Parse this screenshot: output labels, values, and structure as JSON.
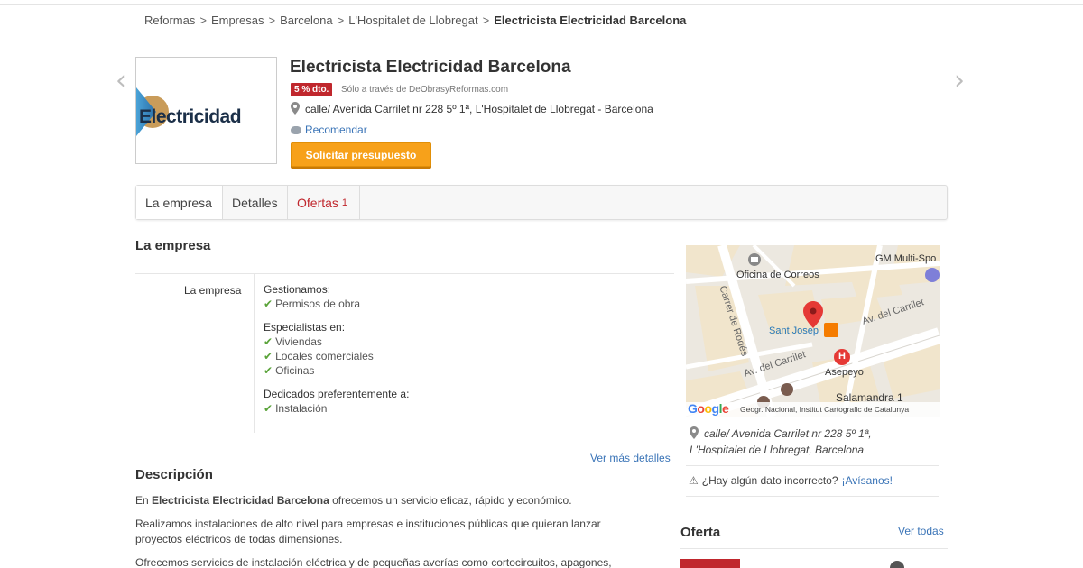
{
  "breadcrumb": [
    {
      "label": "Reformas"
    },
    {
      "label": "Empresas"
    },
    {
      "label": "Barcelona"
    },
    {
      "label": "L'Hospitalet de Llobregat"
    },
    {
      "label": "Electricista Electricidad Barcelona"
    }
  ],
  "breadcrumb_separator": ">",
  "logo": {
    "text": "Electricidad"
  },
  "business": {
    "title": "Electricista Electricidad Barcelona",
    "discount_badge": "5 % dto.",
    "discount_note": "Sólo a través de DeObrasyReformas.com",
    "address": "calle/ Avenida Carrilet nr 228 5º 1ª, L'Hospitalet de Llobregat  -  Barcelona",
    "recommend_label": "Recomendar",
    "quote_button": "Solicitar presupuesto"
  },
  "tabs": [
    {
      "label": "La empresa"
    },
    {
      "label": "Detalles"
    },
    {
      "label": "Ofertas",
      "count": "1"
    }
  ],
  "empresa": {
    "heading": "La empresa",
    "row_label": "La empresa",
    "groups": [
      {
        "title": "Gestionamos:",
        "items": [
          "Permisos de obra"
        ]
      },
      {
        "title": "Especialistas en:",
        "items": [
          "Viviendas",
          "Locales comerciales",
          "Oficinas"
        ]
      },
      {
        "title": "Dedicados preferentemente a:",
        "items": [
          "Instalación"
        ]
      }
    ],
    "more_details": "Ver más detalles"
  },
  "descripcion": {
    "heading": "Descripción",
    "p1_prefix": "En ",
    "p1_bold": "Electricista Electricidad Barcelona",
    "p1_suffix": " ofrecemos un servicio eficaz, rápido y económico.",
    "p2": "Realizamos instalaciones de alto nivel para empresas e instituciones públicas que quieran lanzar proyectos eléctricos de todas dimensiones.",
    "p3": "Ofrecemos servicios de instalación eléctrica y de pequeñas averías como cortocircuitos, apagones,"
  },
  "map": {
    "labels": {
      "correos": "Oficina de Correos",
      "gm": "GM Multi-Spo",
      "rodes": "Carrer de Rodés",
      "carrilet_top": "Av. del Carrilet",
      "carrilet_bottom": "Av. del Carrilet",
      "sant_josep": "Sant Josep",
      "asepeyo": "Asepeyo",
      "salamandra": "Salamandra 1"
    },
    "google": "Google",
    "attribution": "Geogr. Nacional, Institut Cartografic de Catalunya",
    "hospital_letter": "H"
  },
  "side": {
    "address_line1": "calle/ Avenida Carrilet nr 228 5º 1ª,",
    "address_line2": "L'Hospitalet de Llobregat, Barcelona",
    "wrong_question": "¿Hay algún dato incorrecto?",
    "wrong_link": "¡Avísanos!",
    "oferta_heading": "Oferta",
    "ver_todas": "Ver todas"
  },
  "colors": {
    "accent_red": "#c0272d",
    "link_blue": "#3a74b7",
    "button_orange": "#f7a11a",
    "check_green": "#5aa339"
  }
}
